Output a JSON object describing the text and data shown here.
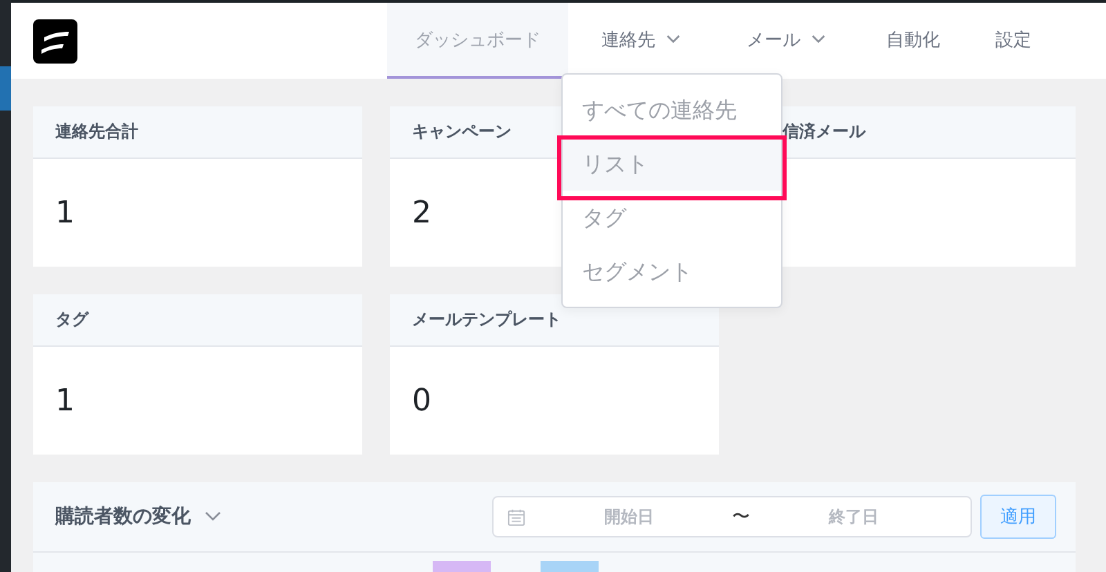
{
  "nav": {
    "tabs": [
      {
        "label": "ダッシュボード",
        "selected": true,
        "dropdown": false
      },
      {
        "label": "連絡先",
        "selected": false,
        "dropdown": true
      },
      {
        "label": "メール",
        "selected": false,
        "dropdown": true
      },
      {
        "label": "自動化",
        "selected": false,
        "dropdown": false
      },
      {
        "label": "設定",
        "selected": false,
        "dropdown": false
      }
    ]
  },
  "stats": [
    {
      "title": "連絡先合計",
      "value": "1"
    },
    {
      "title": "キャンペーン",
      "value": "2"
    },
    {
      "title": "信済メール",
      "covered": true
    },
    {
      "title": "タグ",
      "value": "1"
    },
    {
      "title": "メールテンプレート",
      "value": "0"
    }
  ],
  "dropdown_menu": {
    "items": [
      {
        "label": "すべての連絡先",
        "selected": false
      },
      {
        "label": "リスト",
        "selected": true
      },
      {
        "label": "タグ",
        "selected": false
      },
      {
        "label": "セグメント",
        "selected": false
      }
    ]
  },
  "subscriber_panel": {
    "title": "購読者数の変化",
    "date_range": {
      "start_placeholder": "開始日",
      "separator": "〜",
      "end_placeholder": "終了日"
    },
    "apply_button": "適用"
  }
}
